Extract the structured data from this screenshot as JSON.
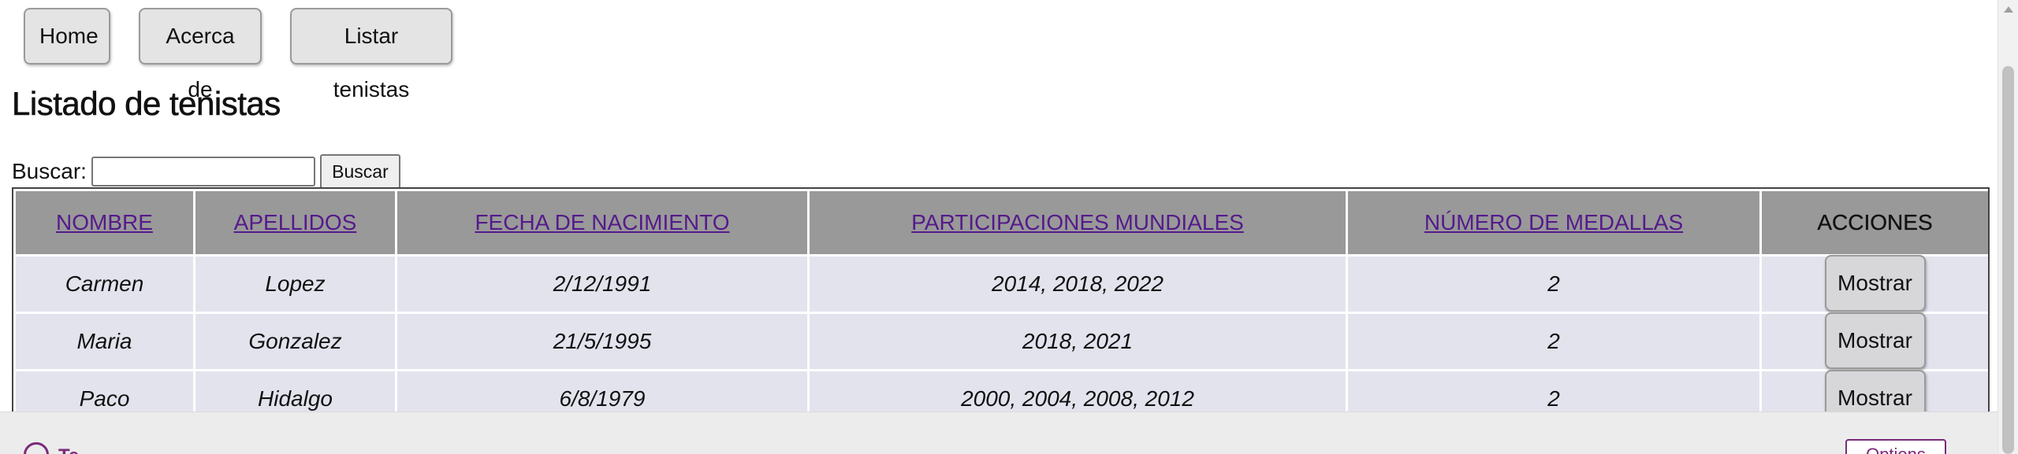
{
  "nav": {
    "items": [
      {
        "label": "Home"
      },
      {
        "label": "Acerca de"
      },
      {
        "label": "Listar tenistas"
      }
    ]
  },
  "page": {
    "title": "Listado de tenistas"
  },
  "search": {
    "label": "Buscar:",
    "value": "",
    "placeholder": "",
    "button_label": "Buscar"
  },
  "table": {
    "headers": [
      {
        "label": "NOMBRE",
        "link": true
      },
      {
        "label": "APELLIDOS",
        "link": true
      },
      {
        "label": "FECHA DE NACIMIENTO",
        "link": true
      },
      {
        "label": "PARTICIPACIONES MUNDIALES",
        "link": true
      },
      {
        "label": "NÚMERO DE MEDALLAS",
        "link": true
      },
      {
        "label": "ACCIONES",
        "link": false
      }
    ],
    "rows": [
      {
        "nombre": "Carmen",
        "apellidos": "Lopez",
        "fecha": "2/12/1991",
        "participaciones": "2014, 2018, 2022",
        "medallas": "2",
        "action_label": "Mostrar"
      },
      {
        "nombre": "Maria",
        "apellidos": "Gonzalez",
        "fecha": "21/5/1995",
        "participaciones": "2018, 2021",
        "medallas": "2",
        "action_label": "Mostrar"
      },
      {
        "nombre": "Paco",
        "apellidos": "Hidalgo",
        "fecha": "6/8/1979",
        "participaciones": "2000, 2004, 2008, 2012",
        "medallas": "2",
        "action_label": "Mostrar"
      }
    ]
  },
  "bottom_bar": {
    "text": "Te…",
    "options_label": "Options",
    "icon": "settings-circle-icon"
  },
  "colors": {
    "header_bg": "#999999",
    "row_bg": "#e3e3ee",
    "link": "#551a8b",
    "accent": "#7b2a7b"
  }
}
